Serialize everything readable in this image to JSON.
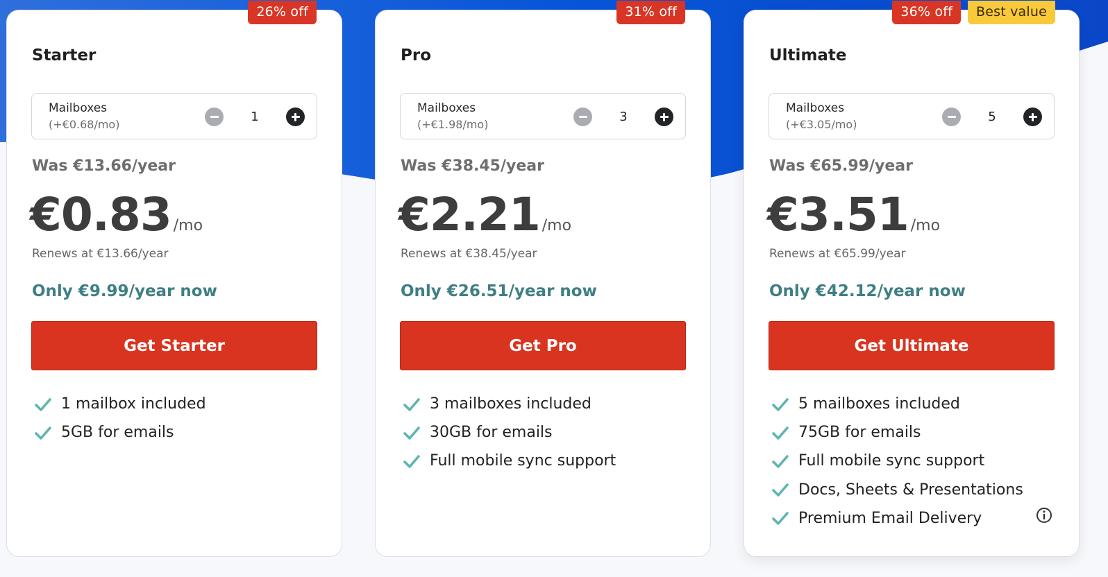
{
  "colors": {
    "cta": "#d93420",
    "discount_badge": "#d93525",
    "best_value_badge": "#f8c93a",
    "only_text": "#3f7f84",
    "check": "#5fb4b0",
    "wave": "#0a52d6"
  },
  "plans": [
    {
      "name": "Starter",
      "badges": {
        "discount": "26% off"
      },
      "mailboxes": {
        "label": "Mailboxes",
        "price": "(+€0.68/mo)",
        "value": "1"
      },
      "was": "Was €13.66/year",
      "price": "€0.83",
      "per": "/mo",
      "renews": "Renews at €13.66/year",
      "only": "Only €9.99/year now",
      "cta": "Get Starter",
      "features": [
        "1 mailbox included",
        "5GB for emails"
      ]
    },
    {
      "name": "Pro",
      "badges": {
        "discount": "31% off"
      },
      "mailboxes": {
        "label": "Mailboxes",
        "price": "(+€1.98/mo)",
        "value": "3"
      },
      "was": "Was €38.45/year",
      "price": "€2.21",
      "per": "/mo",
      "renews": "Renews at €38.45/year",
      "only": "Only €26.51/year now",
      "cta": "Get Pro",
      "features": [
        "3 mailboxes included",
        "30GB for emails",
        "Full mobile sync support"
      ]
    },
    {
      "name": "Ultimate",
      "badges": {
        "discount": "36% off",
        "best": "Best value"
      },
      "mailboxes": {
        "label": "Mailboxes",
        "price": "(+€3.05/mo)",
        "value": "5"
      },
      "was": "Was €65.99/year",
      "price": "€3.51",
      "per": "/mo",
      "renews": "Renews at €65.99/year",
      "only": "Only €42.12/year now",
      "cta": "Get Ultimate",
      "features": [
        "5 mailboxes included",
        "75GB for emails",
        "Full mobile sync support",
        "Docs, Sheets & Presentations",
        "Premium Email Delivery"
      ]
    }
  ]
}
